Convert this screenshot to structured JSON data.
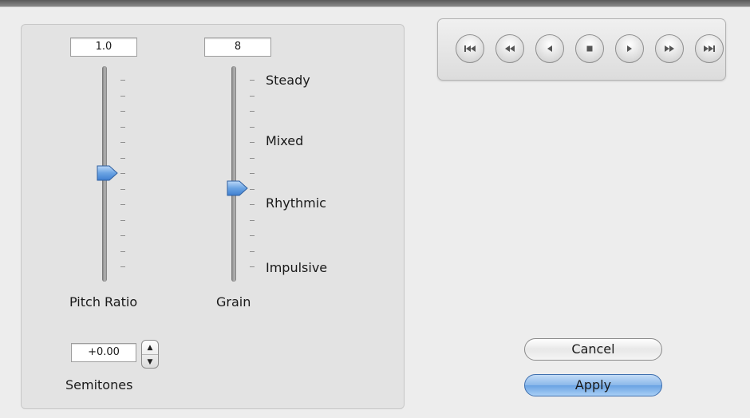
{
  "pitch": {
    "value": "1.0",
    "label": "Pitch Ratio",
    "level": 0.5
  },
  "grain": {
    "value": "8",
    "label": "Grain",
    "level": 0.42,
    "scale": [
      "Steady",
      "Mixed",
      "Rhythmic",
      "Impulsive"
    ]
  },
  "semitones": {
    "value": "+0.00",
    "label": "Semitones"
  },
  "transport": {
    "buttons": [
      "skip-to-start-icon",
      "rewind-icon",
      "step-back-icon",
      "stop-icon",
      "play-icon",
      "fast-forward-icon",
      "skip-to-end-icon"
    ]
  },
  "actions": {
    "cancel": "Cancel",
    "apply": "Apply"
  },
  "colors": {
    "accent": "#6aa3e3",
    "knob": "#5f9ee8"
  }
}
